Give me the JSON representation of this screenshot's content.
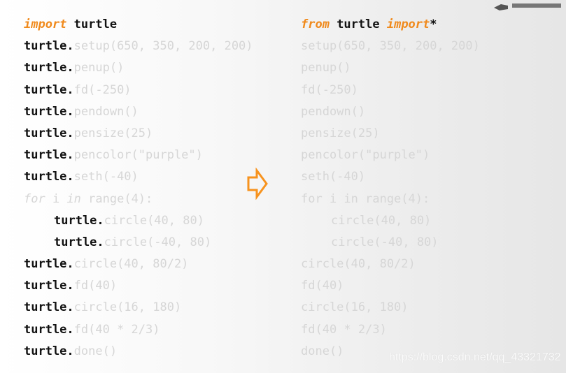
{
  "left": {
    "lines": [
      {
        "indent": 0,
        "segs": [
          {
            "t": "import",
            "c": "kw"
          },
          {
            "t": " turtle",
            "c": "strong"
          }
        ]
      },
      {
        "indent": 0,
        "segs": [
          {
            "t": "turtle.",
            "c": "strong"
          },
          {
            "t": "setup(650, 350, 200, 200)",
            "c": "faint"
          }
        ]
      },
      {
        "indent": 0,
        "segs": [
          {
            "t": "turtle.",
            "c": "strong"
          },
          {
            "t": "penup()",
            "c": "faint"
          }
        ]
      },
      {
        "indent": 0,
        "segs": [
          {
            "t": "turtle.",
            "c": "strong"
          },
          {
            "t": "fd(-250)",
            "c": "faint"
          }
        ]
      },
      {
        "indent": 0,
        "segs": [
          {
            "t": "turtle.",
            "c": "strong"
          },
          {
            "t": "pendown()",
            "c": "faint"
          }
        ]
      },
      {
        "indent": 0,
        "segs": [
          {
            "t": "turtle.",
            "c": "strong"
          },
          {
            "t": "pensize(25)",
            "c": "faint"
          }
        ]
      },
      {
        "indent": 0,
        "segs": [
          {
            "t": "turtle.",
            "c": "strong"
          },
          {
            "t": "pencolor(\"purple\")",
            "c": "faint"
          }
        ]
      },
      {
        "indent": 0,
        "segs": [
          {
            "t": "turtle.",
            "c": "strong"
          },
          {
            "t": "seth(-40)",
            "c": "faint"
          }
        ]
      },
      {
        "indent": 0,
        "segs": [
          {
            "t": "for",
            "c": "dimkw"
          },
          {
            "t": " i ",
            "c": "faint"
          },
          {
            "t": "in",
            "c": "dimkw"
          },
          {
            "t": " range(4):",
            "c": "faint"
          }
        ]
      },
      {
        "indent": 1,
        "segs": [
          {
            "t": "turtle.",
            "c": "strong"
          },
          {
            "t": "circle(40, 80)",
            "c": "faint"
          }
        ]
      },
      {
        "indent": 1,
        "segs": [
          {
            "t": "turtle.",
            "c": "strong"
          },
          {
            "t": "circle(-40, 80)",
            "c": "faint"
          }
        ]
      },
      {
        "indent": 0,
        "segs": [
          {
            "t": "turtle.",
            "c": "strong"
          },
          {
            "t": "circle(40, 80/2)",
            "c": "faint"
          }
        ]
      },
      {
        "indent": 0,
        "segs": [
          {
            "t": "turtle.",
            "c": "strong"
          },
          {
            "t": "fd(40)",
            "c": "faint"
          }
        ]
      },
      {
        "indent": 0,
        "segs": [
          {
            "t": "turtle.",
            "c": "strong"
          },
          {
            "t": "circle(16, 180)",
            "c": "faint"
          }
        ]
      },
      {
        "indent": 0,
        "segs": [
          {
            "t": "turtle.",
            "c": "strong"
          },
          {
            "t": "fd(40 * 2/3)",
            "c": "faint"
          }
        ]
      },
      {
        "indent": 0,
        "segs": [
          {
            "t": "turtle.",
            "c": "strong"
          },
          {
            "t": "done()",
            "c": "faint"
          }
        ]
      }
    ]
  },
  "right": {
    "lines": [
      {
        "indent": 0,
        "segs": [
          {
            "t": "from",
            "c": "kw"
          },
          {
            "t": " turtle ",
            "c": "strong"
          },
          {
            "t": "import",
            "c": "kw"
          },
          {
            "t": "*",
            "c": "strong"
          }
        ]
      },
      {
        "indent": 0,
        "segs": [
          {
            "t": "setup(650, 350, 200, 200)",
            "c": "faint"
          }
        ]
      },
      {
        "indent": 0,
        "segs": [
          {
            "t": "penup()",
            "c": "faint"
          }
        ]
      },
      {
        "indent": 0,
        "segs": [
          {
            "t": "fd(-250)",
            "c": "faint"
          }
        ]
      },
      {
        "indent": 0,
        "segs": [
          {
            "t": "pendown()",
            "c": "faint"
          }
        ]
      },
      {
        "indent": 0,
        "segs": [
          {
            "t": "pensize(25)",
            "c": "faint"
          }
        ]
      },
      {
        "indent": 0,
        "segs": [
          {
            "t": "pencolor(\"purple\")",
            "c": "faint"
          }
        ]
      },
      {
        "indent": 0,
        "segs": [
          {
            "t": "seth(-40)",
            "c": "faint"
          }
        ]
      },
      {
        "indent": 0,
        "segs": [
          {
            "t": "for i in range(4):",
            "c": "faint"
          }
        ]
      },
      {
        "indent": 1,
        "segs": [
          {
            "t": "circle(40, 80)",
            "c": "faint"
          }
        ]
      },
      {
        "indent": 1,
        "segs": [
          {
            "t": "circle(-40, 80)",
            "c": "faint"
          }
        ]
      },
      {
        "indent": 0,
        "segs": [
          {
            "t": "circle(40, 80/2)",
            "c": "faint"
          }
        ]
      },
      {
        "indent": 0,
        "segs": [
          {
            "t": "fd(40)",
            "c": "faint"
          }
        ]
      },
      {
        "indent": 0,
        "segs": [
          {
            "t": "circle(16, 180)",
            "c": "faint"
          }
        ]
      },
      {
        "indent": 0,
        "segs": [
          {
            "t": "fd(40 * 2/3)",
            "c": "faint"
          }
        ]
      },
      {
        "indent": 0,
        "segs": [
          {
            "t": "done()",
            "c": "faint"
          }
        ]
      }
    ]
  },
  "arrow": {
    "icon": "right-arrow-icon",
    "color": "#f7931e"
  },
  "logo": {
    "icon": "mooc-logo-icon"
  },
  "watermark": "https://blog.csdn.net/qq_43321732"
}
